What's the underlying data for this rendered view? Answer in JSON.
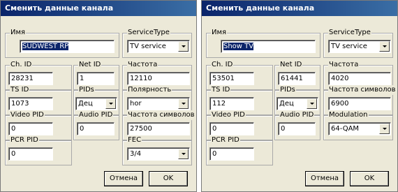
{
  "left": {
    "title": "Сменить данные канала",
    "name_label": "Имя",
    "name_value": "SUDWEST RP",
    "service_label": "ServiceType",
    "service_value": "TV service",
    "chid_label": "Ch. ID",
    "chid_value": "28231",
    "netid_label": "Net ID",
    "netid_value": "1",
    "freq_label": "Частота",
    "freq_value": "12110",
    "tsid_label": "TS ID",
    "tsid_value": "1073",
    "pids_label": "PIDs",
    "pids_value": "Дец",
    "polar_label": "Полярность",
    "polar_value": "hor",
    "vpid_label": "Video PID",
    "vpid_value": "0",
    "apid_label": "Audio PID",
    "apid_value": "0",
    "sym_label": "Частота символов",
    "sym_value": "27500",
    "pcr_label": "PCR PID",
    "pcr_value": "0",
    "fec_label": "FEC",
    "fec_value": "3/4",
    "cancel_label": "Отмена",
    "ok_label": "OK"
  },
  "right": {
    "title": "Сменить данные канала",
    "name_label": "Имя",
    "name_value": "Show TV",
    "service_label": "ServiceType",
    "service_value": "TV service",
    "chid_label": "Ch. ID",
    "chid_value": "53501",
    "netid_label": "Net ID",
    "netid_value": "61441",
    "freq_label": "Частота",
    "freq_value": "4020",
    "tsid_label": "TS ID",
    "tsid_value": "112",
    "pids_label": "PIDs",
    "pids_value": "Дец",
    "sym_label": "Частота символов",
    "sym_value": "6900",
    "vpid_label": "Video PID",
    "vpid_value": "0",
    "apid_label": "Audio PID",
    "apid_value": "0",
    "mod_label": "Modulation",
    "mod_value": "64-QAM",
    "pcr_label": "PCR PID",
    "pcr_value": "0",
    "cancel_label": "Отмена",
    "ok_label": "OK"
  }
}
